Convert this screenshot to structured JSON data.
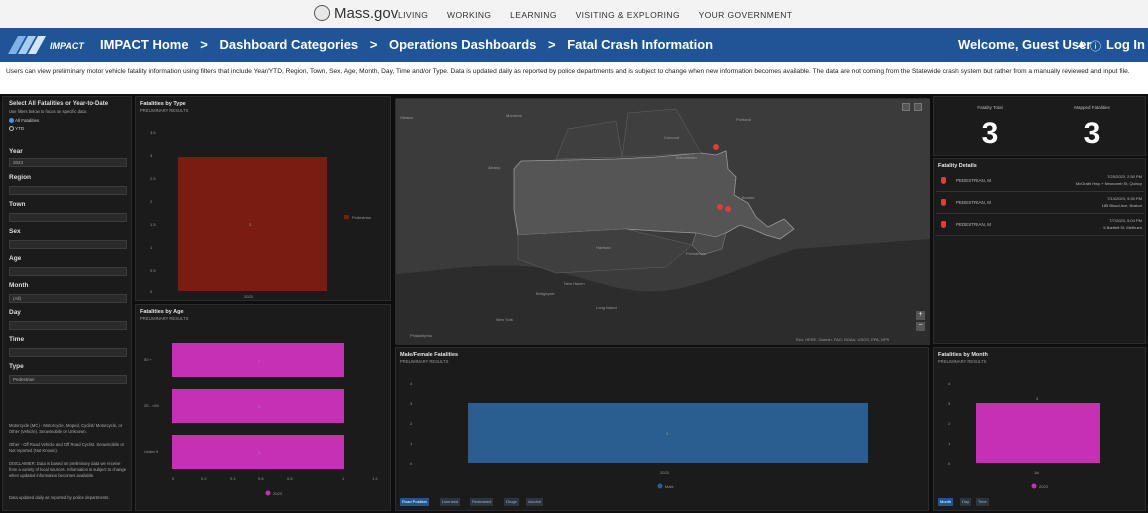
{
  "site": {
    "logo_text": "Mass.gov",
    "nav": [
      "LIVING",
      "WORKING",
      "LEARNING",
      "VISITING & EXPLORING",
      "YOUR GOVERNMENT"
    ]
  },
  "banner": {
    "logo_text": "IMPACT",
    "breadcrumbs": [
      "IMPACT Home",
      ">",
      "Dashboard Categories",
      ">",
      "Operations Dashboards",
      ">",
      "Fatal Crash Information"
    ],
    "welcome": "Welcome, Guest User",
    "login": "Log In"
  },
  "description": "Users can view preliminary motor vehicle fatality information using filters that include Year/YTD, Region, Town, Sex, Age, Month, Day, Time and/or Type. Data is updated daily as reported by police departments and is subject to change when new information becomes available. The data are not coming from the Statewide crash system but rather from a manually reviewed and input file.",
  "filters": {
    "title": "Select All Fatalities or Year-to-Date",
    "subtitle": "Use filters below to focus on specific data.",
    "radio_all": "All Fatalities",
    "radio_ytd": "YTD",
    "fields": [
      {
        "label": "Year",
        "value": "2023"
      },
      {
        "label": "Region",
        "value": ""
      },
      {
        "label": "Town",
        "value": ""
      },
      {
        "label": "Sex",
        "value": ""
      },
      {
        "label": "Age",
        "value": ""
      },
      {
        "label": "Month",
        "value": "(All)"
      },
      {
        "label": "Day",
        "value": ""
      },
      {
        "label": "Time",
        "value": ""
      },
      {
        "label": "Type",
        "value": "Pedestrian"
      }
    ],
    "notes": [
      "Motorcycle (MC) - Motorcycle, Moped, Cyclist/ Motorcycle, or Other (Vehicle). Snowmobile or Unknown.",
      "Other - Off Road Vehicle and Off Road Cyclist. Snowmobile or Not reported (Not Known).",
      "DISCLAIMER: Data is based on preliminary data we receive from a variety of local sources. Information is subject to change when updated information becomes available.",
      "Data updated daily as reported by police departments."
    ]
  },
  "type_chart": {
    "title": "Fatalities by Type",
    "subtitle": "PRELIMINARY RESULTS",
    "legend": "Pedestrian",
    "bar_label": "3",
    "category": "2023",
    "yticks": [
      "3.5",
      "3",
      "2.5",
      "2",
      "1.5",
      "1",
      "0.5",
      "0"
    ]
  },
  "age_chart": {
    "title": "Fatalities by Age",
    "subtitle": "PRELIMINARY RESULTS",
    "categories": [
      "50 +",
      "25 - <50",
      "Under 5"
    ],
    "values": [
      1,
      1,
      1
    ],
    "xticks": [
      "0",
      "0.2",
      "0.4",
      "0.6",
      "0.8",
      "1",
      "1.2"
    ],
    "legend": "2023"
  },
  "map": {
    "labels": [
      "Ottawa",
      "Montreal",
      "Concord",
      "Portland",
      "Manchester",
      "Boston",
      "Albany",
      "Hartford",
      "Providence",
      "New Haven",
      "Bridgeport",
      "New York",
      "Philadelphia",
      "Long Island"
    ],
    "attribution": "Esri, HERE, Garmin, FAO, NOAA, USGS, EPA, NPS"
  },
  "gender_chart": {
    "title": "Male/Female Fatalities",
    "subtitle": "PRELIMINARY RESULTS",
    "bar_label": "3",
    "category": "2023",
    "legend": "Male",
    "yticks": [
      "4",
      "3",
      "2",
      "1",
      "0"
    ],
    "tabs": [
      "Road Position",
      "Licensed",
      "Restrained",
      "Drugs",
      "Alcohol"
    ]
  },
  "kpi": {
    "total_label": "Fatality Total",
    "total_value": "3",
    "mapped_label": "Mapped Fatalities",
    "mapped_value": "3"
  },
  "details": {
    "title": "Fatality Details",
    "rows": [
      {
        "type": "PEDESTRIAN, M",
        "date": "7/25/2023, 2:30 PM",
        "location": "McGrath Hwy + Newcomb St, Quincy"
      },
      {
        "type": "PEDESTRIAN, M",
        "date": "7/14/2023, 9:30 PM",
        "location": "185 Blood Ave, Boston"
      },
      {
        "type": "PEDESTRIAN, M",
        "date": "7/7/2023, 5:04 PM",
        "location": "5 Bartlett St, Methuen"
      }
    ]
  },
  "month_chart": {
    "title": "Fatalities by Month",
    "subtitle": "PRELIMINARY RESULTS",
    "bar_label": "3",
    "category": "Jul",
    "legend": "2023",
    "yticks": [
      "4",
      "3",
      "2",
      "1",
      "0"
    ],
    "tabs": [
      "Month",
      "Day",
      "Time"
    ]
  },
  "colors": {
    "banner": "#1f5597",
    "type_bar": "#7a1c12",
    "age_bar": "#c530b5",
    "gender_bar": "#2a5e91",
    "month_bar": "#c530b5"
  },
  "chart_data": [
    {
      "type": "bar",
      "title": "Fatalities by Type",
      "categories": [
        "2023"
      ],
      "series": [
        {
          "name": "Pedestrian",
          "values": [
            3
          ]
        }
      ],
      "ylim": [
        0,
        3.5
      ]
    },
    {
      "type": "bar",
      "title": "Fatalities by Age",
      "categories": [
        "50 +",
        "25 - <50",
        "Under 5"
      ],
      "series": [
        {
          "name": "2023",
          "values": [
            1,
            1,
            1
          ]
        }
      ],
      "xlim": [
        0,
        1.2
      ]
    },
    {
      "type": "bar",
      "title": "Male/Female Fatalities",
      "categories": [
        "2023"
      ],
      "series": [
        {
          "name": "Male",
          "values": [
            3
          ]
        }
      ],
      "ylim": [
        0,
        4
      ]
    },
    {
      "type": "bar",
      "title": "Fatalities by Month",
      "categories": [
        "Jul"
      ],
      "series": [
        {
          "name": "2023",
          "values": [
            3
          ]
        }
      ],
      "ylim": [
        0,
        4
      ]
    }
  ]
}
